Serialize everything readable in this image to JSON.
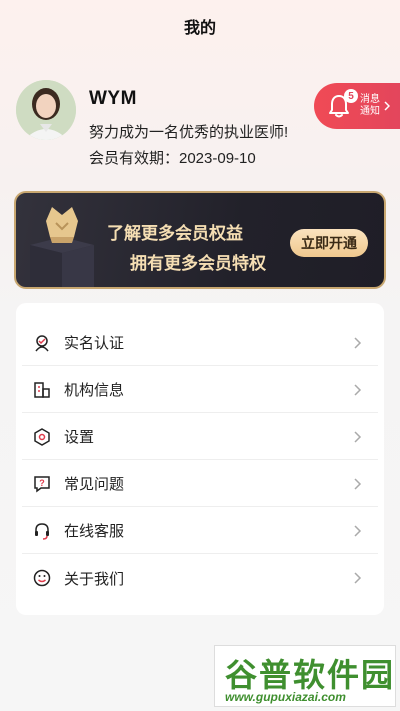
{
  "header": {
    "title": "我的"
  },
  "profile": {
    "name": "WYM",
    "motto": "努力成为一名优秀的执业医师!",
    "expiry_label": "会员有效期：2023-09-10"
  },
  "notifications": {
    "count": "5",
    "label_line1": "消息",
    "label_line2": "通知"
  },
  "vip": {
    "line1": "了解更多会员权益",
    "line2": "拥有更多会员特权",
    "cta": "立即开通",
    "accent": "#c8a770"
  },
  "menu": {
    "items": [
      {
        "label": "实名认证",
        "icon": "verify-icon"
      },
      {
        "label": "机构信息",
        "icon": "building-icon"
      },
      {
        "label": "设置",
        "icon": "gear-icon"
      },
      {
        "label": "常见问题",
        "icon": "question-icon"
      },
      {
        "label": "在线客服",
        "icon": "headset-icon"
      },
      {
        "label": "关于我们",
        "icon": "smile-icon"
      }
    ]
  },
  "watermark": {
    "top": "谷普软件园",
    "bottom": "www.gupuxiazai.com"
  },
  "colors": {
    "brand_red": "#e3465c",
    "icon_red": "#e03c4c"
  }
}
